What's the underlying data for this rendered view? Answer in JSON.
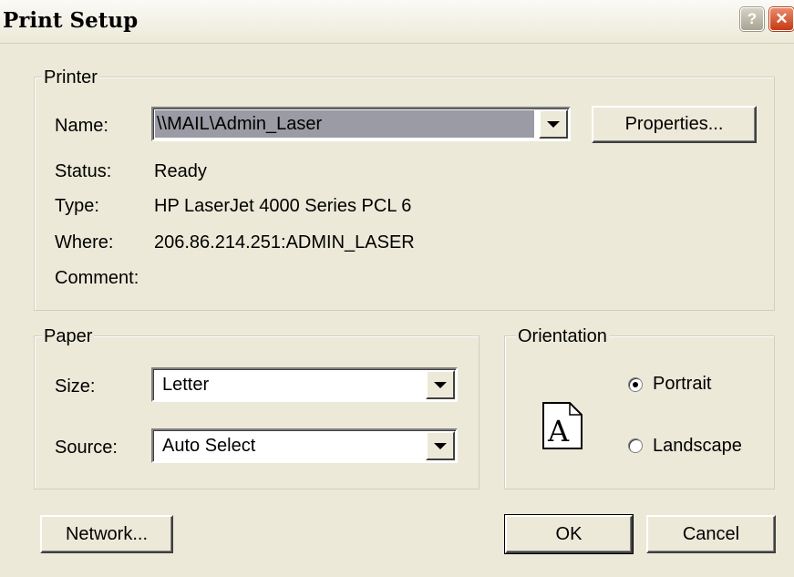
{
  "window": {
    "title": "Print Setup",
    "help_button": "?",
    "close_button": "✕"
  },
  "printer": {
    "legend": "Printer",
    "name_label": "Name:",
    "name_value": "\\\\MAIL\\Admin_Laser",
    "properties_button": "Properties...",
    "status_label": "Status:",
    "status_value": "Ready",
    "type_label": "Type:",
    "type_value": "HP LaserJet 4000 Series PCL 6",
    "where_label": "Where:",
    "where_value": "206.86.214.251:ADMIN_LASER",
    "comment_label": "Comment:",
    "comment_value": ""
  },
  "paper": {
    "legend": "Paper",
    "size_label": "Size:",
    "size_value": "Letter",
    "source_label": "Source:",
    "source_value": "Auto Select"
  },
  "orientation": {
    "legend": "Orientation",
    "page_glyph": "A",
    "portrait_label": "Portrait",
    "landscape_label": "Landscape",
    "selected": "Portrait"
  },
  "buttons": {
    "network": "Network...",
    "ok": "OK",
    "cancel": "Cancel"
  }
}
